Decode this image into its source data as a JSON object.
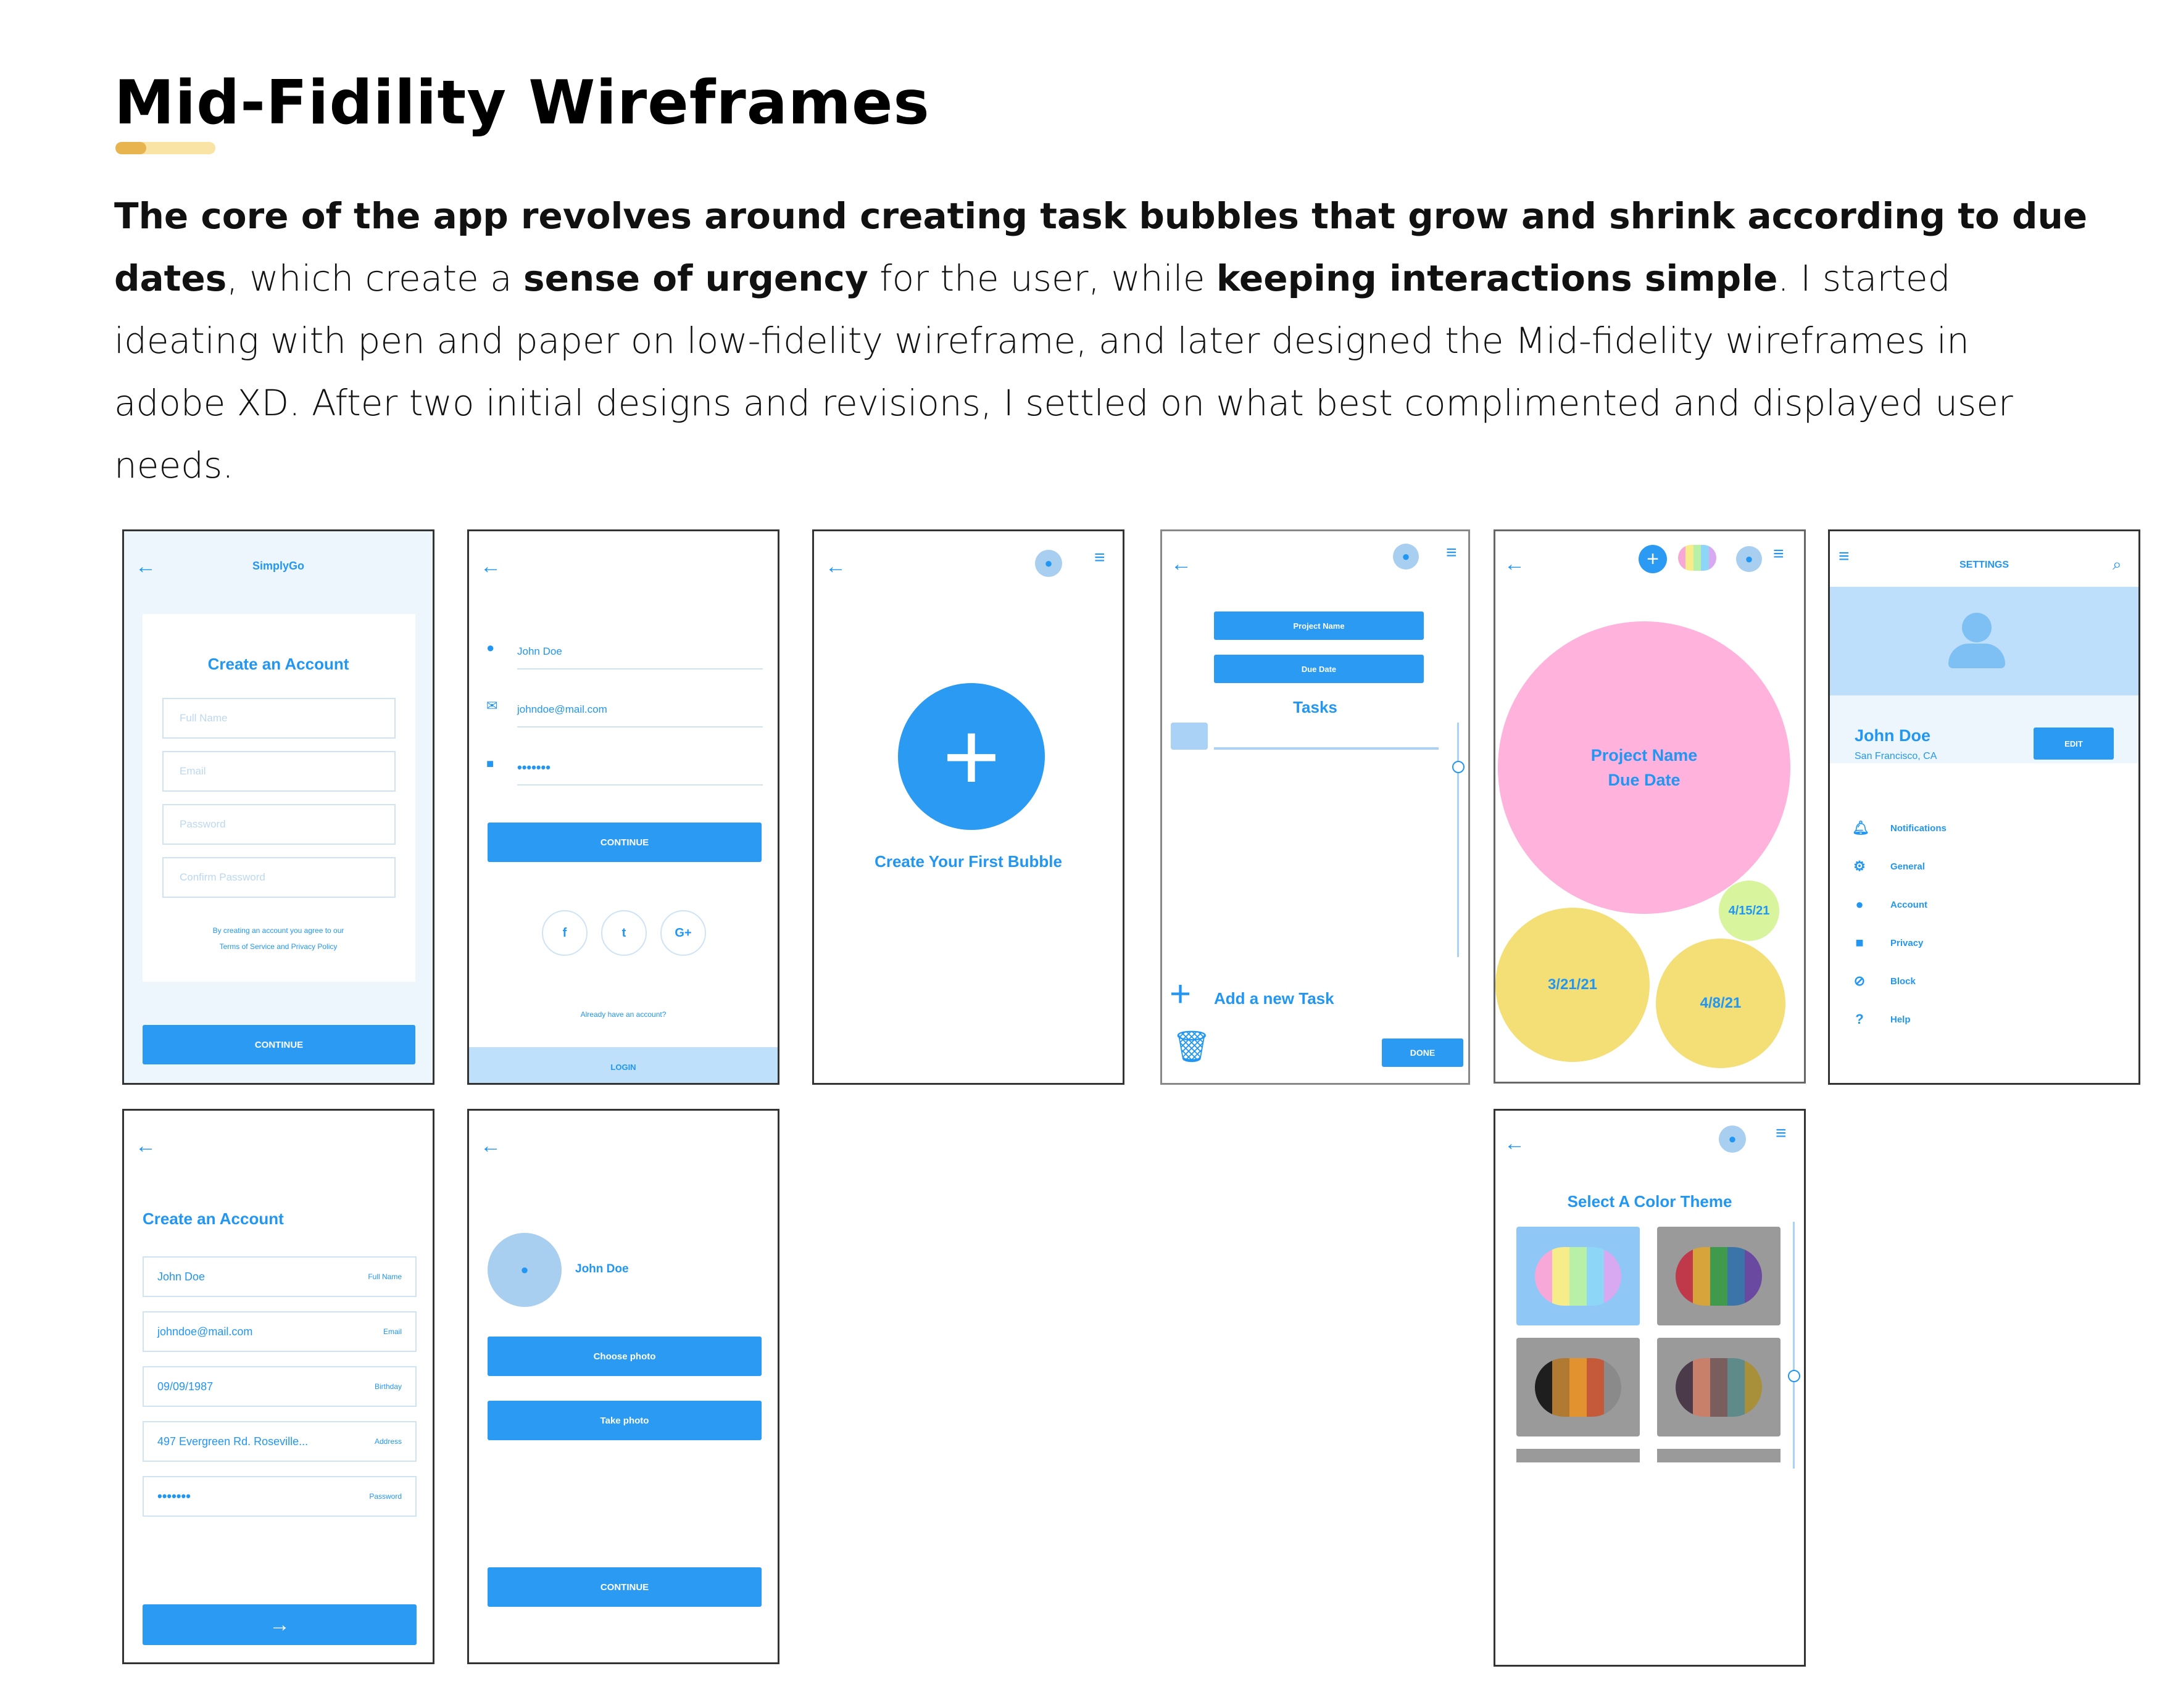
{
  "page": {
    "title": "Mid-Fidility Wireframes",
    "accent_colors": {
      "underline_dark": "#e8b44f",
      "underline_light": "#f9e4a6",
      "brand_blue": "#2196f3"
    },
    "description": {
      "bold1": "The core of the app revolves around creating task bubbles that grow and shrink according to due dates",
      "t1": ", which create a ",
      "bold2": "sense of urgency",
      "t2": " for the user, while ",
      "bold3": "keeping interactions simple",
      "t3": ". I started ideating with pen and paper on low-fidelity wireframe, and later designed the Mid-fidelity wireframes in adobe XD. After two initial designs and revisions, I settled on what best complimented and displayed user needs."
    }
  },
  "screen1": {
    "app_name": "SimplyGo",
    "heading": "Create an Account",
    "fields": [
      "Full Name",
      "Email",
      "Password",
      "Confirm Password"
    ],
    "terms_line1": "By creating an account you agree to our",
    "terms_line2": "Terms of Service and Privacy Policy",
    "continue": "CONTINUE"
  },
  "screen2": {
    "name": "John Doe",
    "email": "johndoe@mail.com",
    "password": "•••••••",
    "continue": "CONTINUE",
    "socials": [
      "f",
      "t",
      "G+"
    ],
    "already": "Already have an account?",
    "login": "LOGIN"
  },
  "screen3": {
    "cta": "Create Your First Bubble"
  },
  "screen4": {
    "project_name": "Project Name",
    "due_date": "Due Date",
    "tasks": "Tasks",
    "add_task": "Add a new Task",
    "done": "DONE"
  },
  "screen5": {
    "big_bubble_line1": "Project Name",
    "big_bubble_line2": "Due Date",
    "dates": [
      "3/21/21",
      "4/8/21",
      "4/15/21"
    ]
  },
  "screen6": {
    "title": "SETTINGS",
    "name": "John Doe",
    "location": "San Francisco, CA",
    "edit": "EDIT",
    "items": [
      "Notifications",
      "General",
      "Account",
      "Privacy",
      "Block",
      "Help"
    ]
  },
  "screen7": {
    "heading": "Create an Account",
    "fields": [
      {
        "value": "John Doe",
        "label": "Full Name"
      },
      {
        "value": "johndoe@mail.com",
        "label": "Email"
      },
      {
        "value": "09/09/1987",
        "label": "Birthday"
      },
      {
        "value": "497 Evergreen Rd. Roseville...",
        "label": "Address"
      },
      {
        "value": "•••••••",
        "label": "Password"
      }
    ],
    "next": "→"
  },
  "screen8": {
    "name": "John Doe",
    "choose_photo": "Choose photo",
    "take_photo": "Take photo",
    "continue": "CONTINUE"
  },
  "screen9": {
    "heading": "Select A Color Theme"
  }
}
